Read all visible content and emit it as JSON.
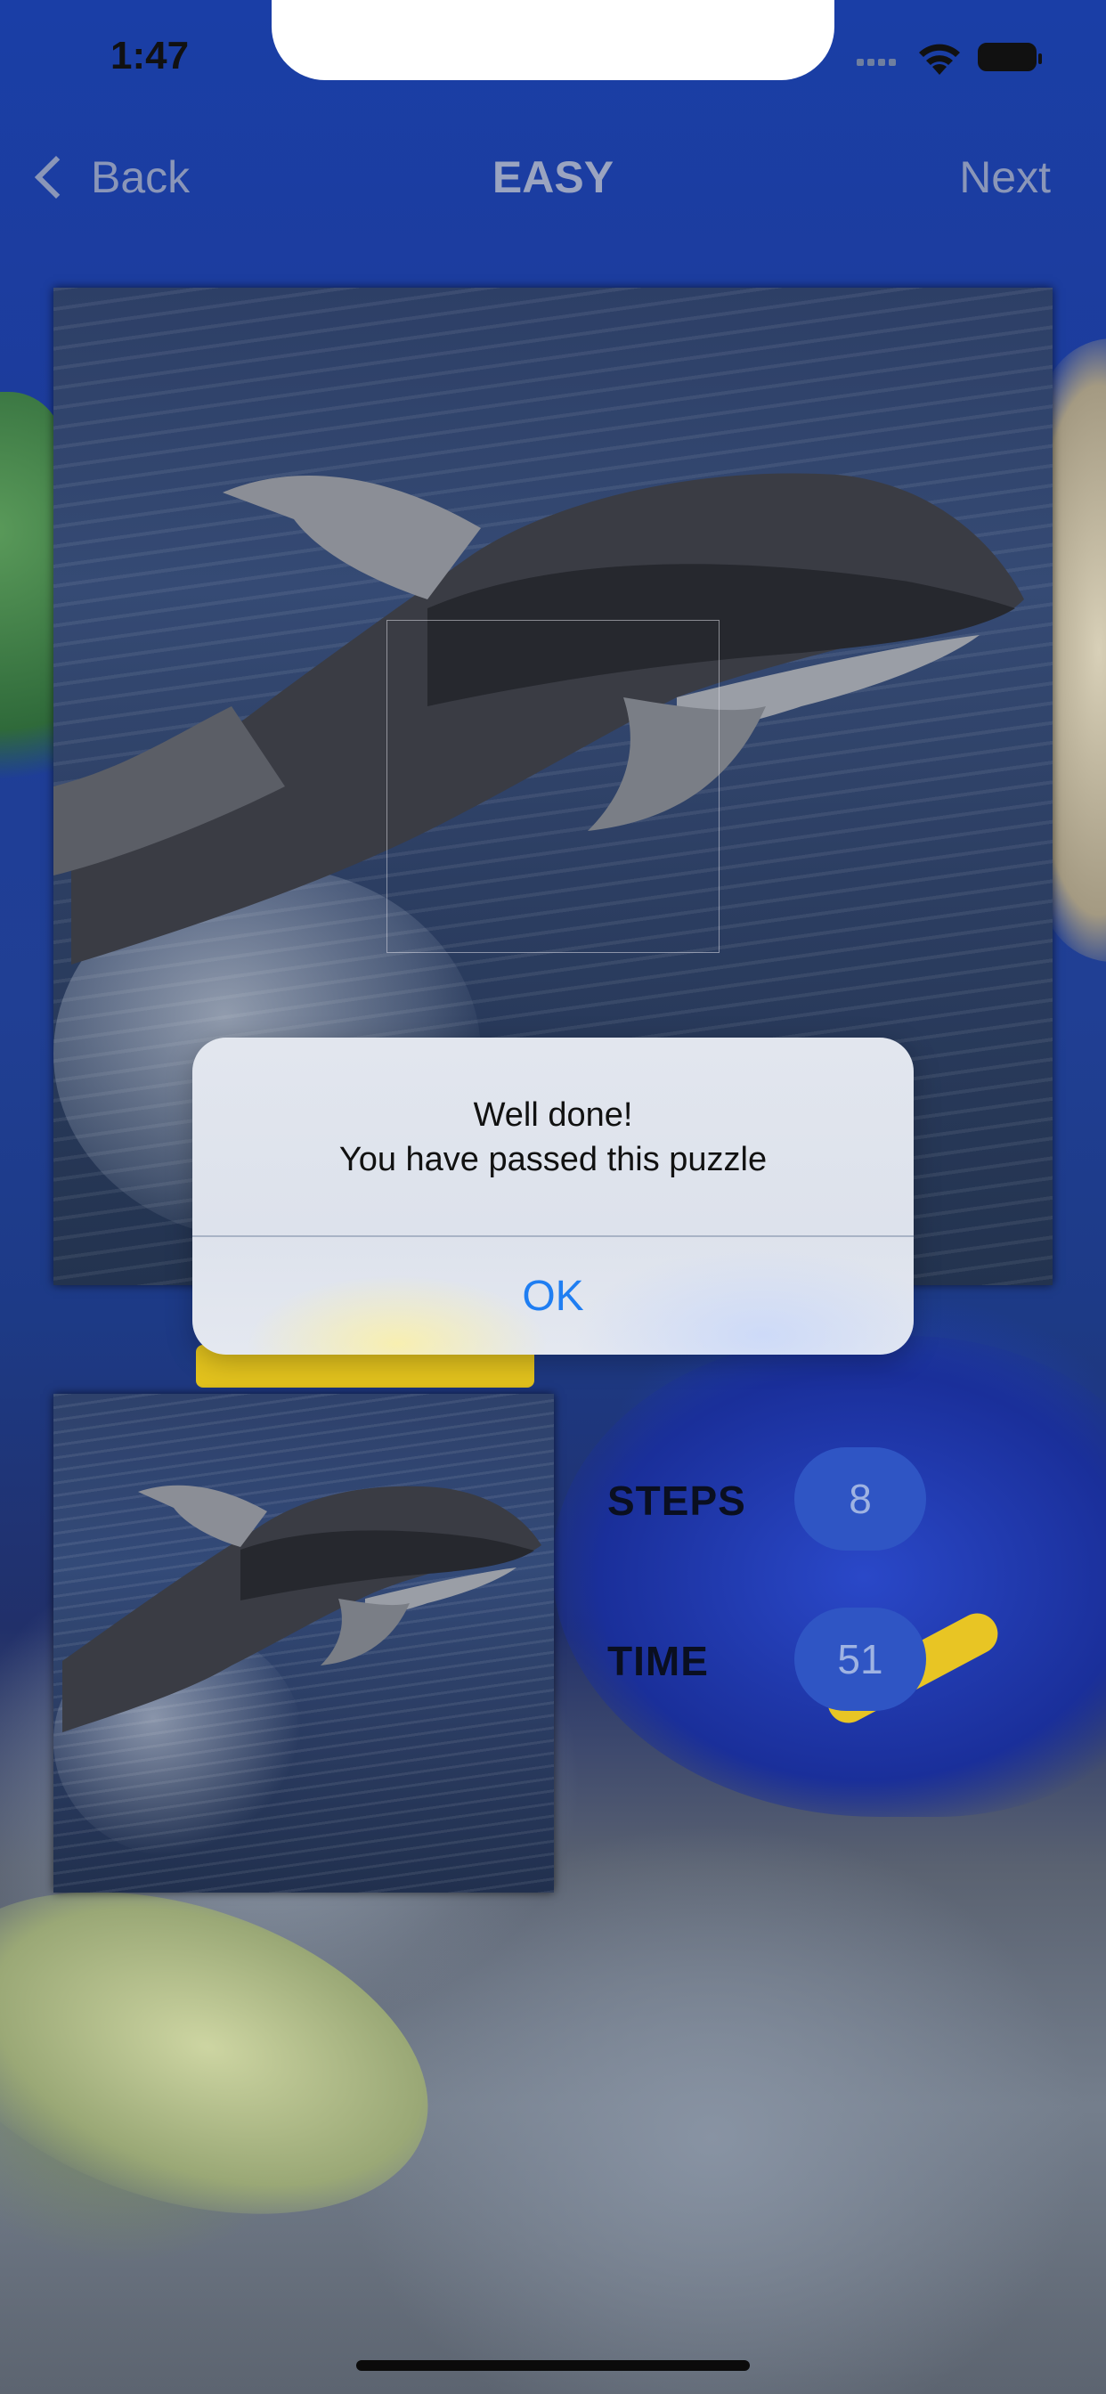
{
  "status_bar": {
    "time": "1:47"
  },
  "nav": {
    "back_label": "Back",
    "title": "EASY",
    "next_label": "Next"
  },
  "alert": {
    "title": "Well done!",
    "message": "You have passed this puzzle",
    "ok_label": "OK"
  },
  "stats": {
    "steps_label": "STEPS",
    "steps_value": "8",
    "time_label": "TIME",
    "time_value": "51"
  },
  "colors": {
    "accent_pill": "#2f55c4",
    "alert_button": "#1f7ef2"
  },
  "icons": [
    "chevron-left-icon",
    "cellular-signal-icon",
    "wifi-icon",
    "battery-icon"
  ]
}
